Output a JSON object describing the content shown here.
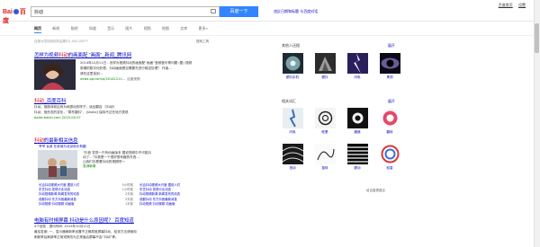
{
  "logo": {
    "text1": "Bai",
    "text2": "百度"
  },
  "search": {
    "query": "抖动",
    "button": "百度一下"
  },
  "toplinks": "违反日期和标题  与百度对话",
  "topright": [
    "百度首页",
    "设置"
  ],
  "nav": {
    "tabs": [
      "网页",
      "新闻",
      "贴吧",
      "知道",
      "音乐",
      "图片",
      "视频",
      "地图",
      "文库",
      "更多»"
    ],
    "active": "网页"
  },
  "result_count": "百度为您找到相关结果约1,000,000个",
  "search_tools": "搜索工具",
  "results": [
    {
      "title_pre": "怎样为视频",
      "title_em": "抖动",
      "title_post": "的画面配 “画面”_新闻_腾讯网",
      "abstract": "2014年12月11日 - 怎样为视频抖动的画面配“画面”音频音乐等问题 (图) 视频",
      "abstract2": "剪辑的数字化处理，抖动画面是否需要先进行稳定处理？ 作者...",
      "abstract3": "请在这里找到...",
      "url": "news.qq.com/a/20141211...",
      "snapshot": "百度快照"
    },
    {
      "title_pre": "",
      "title_em": "抖动",
      "title_post": "_百度百科",
      "abstract": "抖动，指肢体前后有为地振动的样子。读出翻自 《抖动》",
      "abstract2": "抖动，指形态的变化，“寒冬翻抖”，[shake] 保持不过在地方表现",
      "abstract3": "",
      "url": "baike.baidu.com  2015-04-07",
      "snapshot": ""
    },
    {
      "title_pre": "",
      "title_em": "抖动",
      "title_post": "的最新相关信息",
      "abstract": "",
      "abstract2": "",
      "abstract3": "",
      "url": "",
      "snapshot": ""
    }
  ],
  "news_block": {
    "head": "爷爷 女孩  在老城与北京街头有趣",
    "desc1": "“抖音 发现一只有动画版本 据说视频中不可能抖",
    "desc2": "动了…”抖音是一个很好很有趣的东西…",
    "desc3": "让我们去看看抖动的视频吧～",
    "source": "澎湃新闻",
    "list": [
      {
        "text": "长治抖动视频大尺度 据说人们",
        "n": "5小时前"
      },
      {
        "text": "东芝抖动 发现行业动态",
        "n": "1小时前"
      },
      {
        "text": "抖动视频新闻 新闻发布的动态",
        "n": "2天前"
      },
      {
        "text": "成都抖动 东方抖音最新消息",
        "n": "3天前"
      },
      {
        "text": "抖动视频 抖动视频 动画版",
        "n": "1天前"
      }
    ]
  },
  "result4": {
    "title": "电脑有时候屏幕 抖动是什么原因呢？ 百度知道",
    "abstract": "4个回答 - 提问时间: 2015年10月11日",
    "abstract2": "最佳答案: 一、显示器刷新率设置不正确导致屏幕抖动，检查方法请使用",
    "abstract3": "刷新率后刷新率正常或修改为正常值后屏幕不会“抖动”等。"
  },
  "right": {
    "head1": "其他人还搜",
    "fold1": "展开",
    "items1": [
      "颤抖手机",
      "颤抖",
      "闪电",
      "黑洞"
    ],
    "head2": "相关词汇",
    "fold2": "展开",
    "items2": [
      "闪电",
      "眩晕",
      "震撼",
      "翻转",
      "扭动",
      "旋转",
      "颤动",
      "蚊香"
    ],
    "more": "给百度提建议"
  }
}
